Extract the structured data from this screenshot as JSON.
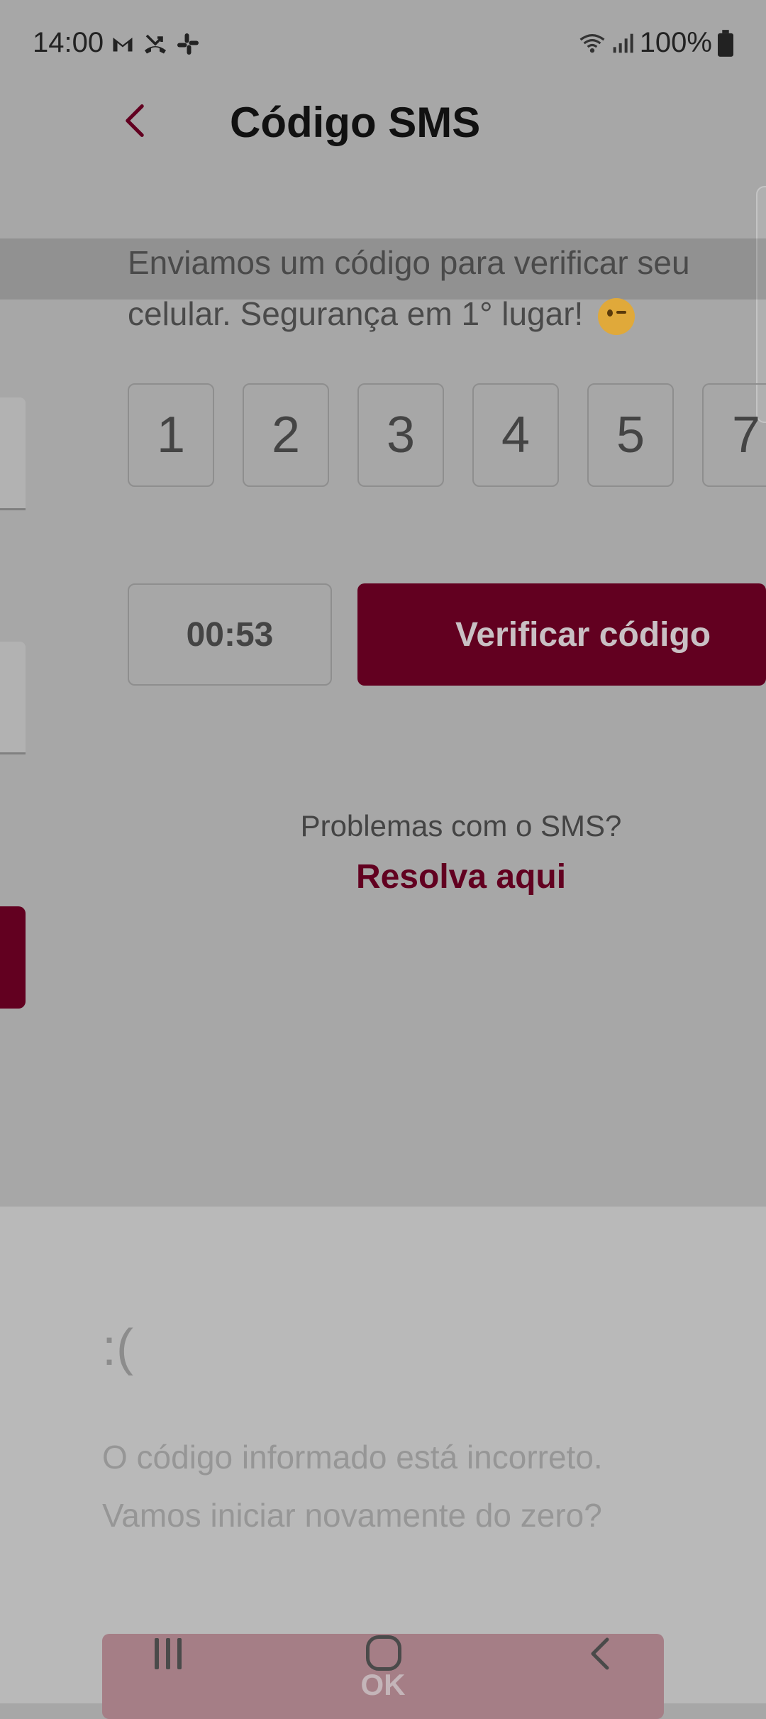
{
  "status_bar": {
    "time": "14:00",
    "battery": "100%",
    "notification_icons": [
      "gmail-icon",
      "missed-call-icon",
      "slack-icon"
    ]
  },
  "header": {
    "title": "Código SMS"
  },
  "intro": {
    "text": "Enviamos um código para verificar seu celular. Segurança em 1° lugar!"
  },
  "code_digits": [
    "1",
    "2",
    "3",
    "4",
    "5",
    "7"
  ],
  "timer": "00:53",
  "verify_button": "Verificar código",
  "help": {
    "question": "Problemas com o SMS?",
    "link": "Resolva aqui"
  },
  "error_sheet": {
    "emoticon": ":(",
    "line1": "O código informado está incorreto.",
    "line2": "Vamos iniciar novamente do zero?",
    "ok_label": "OK"
  },
  "colors": {
    "brand": "#620020",
    "background": "#a7a7a7",
    "sheet": "#b9b9b9"
  }
}
